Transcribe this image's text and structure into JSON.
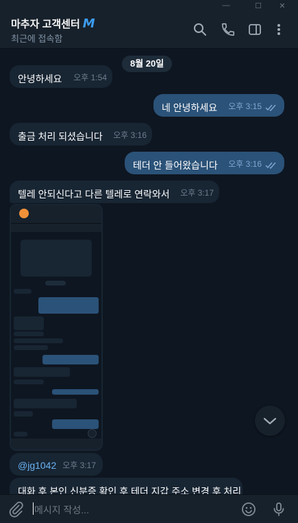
{
  "window": {
    "buttons": [
      {
        "name": "minimize",
        "glyph": "—"
      },
      {
        "name": "maximize",
        "glyph": "☐"
      },
      {
        "name": "close",
        "glyph": "✕"
      }
    ]
  },
  "header": {
    "title": "마추자 고객센터",
    "verified_glyph": "M",
    "status": "최근에 접속함",
    "icons": [
      "search-icon",
      "phone-icon",
      "sidebar-icon",
      "more-icon"
    ]
  },
  "chat": {
    "date_label": "8월 20일",
    "messages": [
      {
        "dir": "in",
        "text": "안녕하세요",
        "time": "오후 1:54"
      },
      {
        "dir": "out",
        "text": "네 안녕하세요",
        "time": "오후 3:15",
        "read": true
      },
      {
        "dir": "in",
        "text": "출금 처리 되셨습니다",
        "time": "오후 3:16"
      },
      {
        "dir": "out",
        "text": "테더 안 들어왔습니다",
        "time": "오후 3:16",
        "read": true
      },
      {
        "dir": "in",
        "text": "텔레 안되신다고 다른 텔레로 연락와서",
        "time": "오후 3:17"
      },
      {
        "dir": "in",
        "type": "photo",
        "text": "",
        "time": ""
      },
      {
        "dir": "in",
        "text": "@jg1042",
        "time": "오후 3:17"
      },
      {
        "dir": "in",
        "text": "대화 후 본인 신분증 확인 후 테더 지갑 주소 변경 후 처리",
        "time": ""
      }
    ]
  },
  "input": {
    "placeholder": "메시지 작성...",
    "icons": [
      "attach-icon",
      "emoji-icon",
      "mic-icon"
    ]
  },
  "colors": {
    "background": "#0e1621",
    "panel": "#17212b",
    "incoming": "#182533",
    "outgoing": "#2b5278",
    "accent": "#6ab3f3",
    "verified": "#3d9cf0"
  }
}
